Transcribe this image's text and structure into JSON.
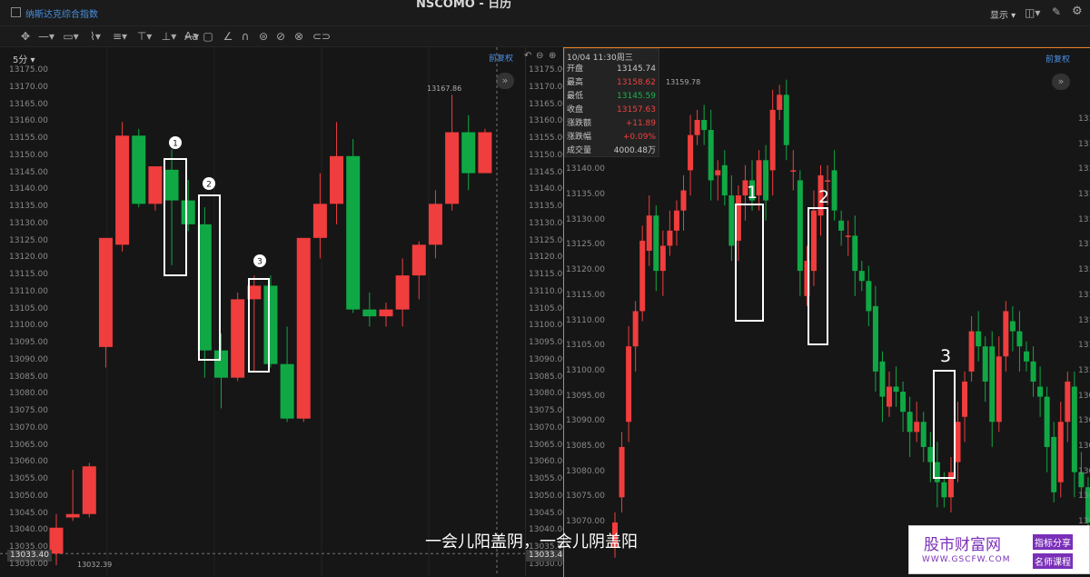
{
  "window": {
    "instrument_title": "纳斯达克综合指数",
    "center_title": "NSCOMO - 日历",
    "display_label": "显示"
  },
  "left_chart": {
    "timeframe": "5分",
    "adjust_label": "前复权",
    "high_marker": "13167.86",
    "low_marker": "13032.39",
    "last_price_tag": "13033.40",
    "y_ticks": [
      "13175.00",
      "13170.00",
      "13165.00",
      "13160.00",
      "13155.00",
      "13150.00",
      "13145.00",
      "13140.00",
      "13135.00",
      "13130.00",
      "13125.00",
      "13120.00",
      "13115.00",
      "13110.00",
      "13105.00",
      "13100.00",
      "13095.00",
      "13090.00",
      "13085.00",
      "13080.00",
      "13075.00",
      "13070.00",
      "13065.00",
      "13060.00",
      "13055.00",
      "13050.00",
      "13045.00",
      "13040.00",
      "13035.00",
      "13030.00"
    ],
    "box_labels": [
      "1",
      "2",
      "3"
    ]
  },
  "right_chart": {
    "adjust_label": "前复权",
    "high_marker": "13159.78",
    "y_ticks": [
      "13150.00",
      "13145.00",
      "13140.00",
      "13135.00",
      "13130.00",
      "13125.00",
      "13120.00",
      "13115.00",
      "13110.00",
      "13105.00",
      "13100.00",
      "13095.00",
      "13090.00",
      "13085.00",
      "13080.00",
      "13075.00",
      "13070.00"
    ],
    "box_labels": [
      "1",
      "2",
      "3"
    ]
  },
  "info": {
    "datetime": "10/04 11:30周三",
    "rows": [
      {
        "k": "开盘",
        "v": "13145.74",
        "color": "#c8c8c8"
      },
      {
        "k": "最高",
        "v": "13158.62",
        "color": "#f04040"
      },
      {
        "k": "最低",
        "v": "13145.59",
        "color": "#19b24b"
      },
      {
        "k": "收盘",
        "v": "13157.63",
        "color": "#f04040"
      },
      {
        "k": "涨跌额",
        "v": "+11.89",
        "color": "#f04040"
      },
      {
        "k": "涨跌幅",
        "v": "+0.09%",
        "color": "#f04040"
      },
      {
        "k": "成交量",
        "v": "4000.48万",
        "color": "#c8c8c8"
      }
    ]
  },
  "subtitle": "一会儿阳盖阴，一会儿阴盖阳",
  "watermark": {
    "brand": "股市财富网",
    "url": "WWW.GSCFW.COM",
    "tag1": "指标分享",
    "tag2": "名师课程"
  },
  "colors": {
    "up": "#f03d3d",
    "down": "#10a845",
    "bg": "#161616",
    "accent": "#4a90e2"
  },
  "chart_data": {
    "type": "candlestick",
    "left": {
      "candles": [
        {
          "o": 13033.4,
          "h": 13045,
          "l": 13030,
          "c": 13041
        },
        {
          "o": 13044,
          "h": 13058,
          "l": 13043,
          "c": 13045
        },
        {
          "o": 13045,
          "h": 13060,
          "l": 13044,
          "c": 13059
        },
        {
          "o": 13094,
          "h": 13124,
          "l": 13088,
          "c": 13126
        },
        {
          "o": 13124,
          "h": 13160,
          "l": 13122,
          "c": 13156
        },
        {
          "o": 13156,
          "h": 13158,
          "l": 13135,
          "c": 13136
        },
        {
          "o": 13136,
          "h": 13147,
          "l": 13134,
          "c": 13147
        },
        {
          "o": 13146,
          "h": 13152,
          "l": 13118,
          "c": 13137
        },
        {
          "o": 13137,
          "h": 13143,
          "l": 13128,
          "c": 13130
        },
        {
          "o": 13130,
          "h": 13135,
          "l": 13085,
          "c": 13093
        },
        {
          "o": 13093,
          "h": 13098,
          "l": 13076,
          "c": 13085
        },
        {
          "o": 13085,
          "h": 13110,
          "l": 13084,
          "c": 13108
        },
        {
          "o": 13108,
          "h": 13115,
          "l": 13087,
          "c": 13112
        },
        {
          "o": 13112,
          "h": 13115,
          "l": 13088,
          "c": 13089
        },
        {
          "o": 13089,
          "h": 13100,
          "l": 13072,
          "c": 13073
        },
        {
          "o": 13073,
          "h": 13126,
          "l": 13072,
          "c": 13126
        },
        {
          "o": 13126,
          "h": 13145,
          "l": 13120,
          "c": 13136
        },
        {
          "o": 13136,
          "h": 13160,
          "l": 13130,
          "c": 13150
        },
        {
          "o": 13150,
          "h": 13155,
          "l": 13104,
          "c": 13105
        },
        {
          "o": 13105,
          "h": 13110,
          "l": 13100,
          "c": 13103
        },
        {
          "o": 13103,
          "h": 13107,
          "l": 13100,
          "c": 13105
        },
        {
          "o": 13105,
          "h": 13120,
          "l": 13100,
          "c": 13115
        },
        {
          "o": 13115,
          "h": 13125,
          "l": 13108,
          "c": 13124
        },
        {
          "o": 13124,
          "h": 13140,
          "l": 13120,
          "c": 13136
        },
        {
          "o": 13136,
          "h": 13168,
          "l": 13134,
          "c": 13157
        },
        {
          "o": 13157,
          "h": 13162,
          "l": 13140,
          "c": 13145
        },
        {
          "o": 13145,
          "h": 13158,
          "l": 13145,
          "c": 13157
        }
      ]
    },
    "right": {
      "candles_close": [
        13070,
        13085,
        13105,
        13112,
        13126,
        13131,
        13120,
        13125,
        13128,
        13132,
        13136,
        13147,
        13150,
        13148,
        13138,
        13140,
        13135,
        13125,
        13135,
        13138,
        13134,
        13142,
        13134,
        13152,
        13155,
        13145,
        13140,
        13120,
        13122,
        13132,
        13139,
        13138,
        13132,
        13128,
        13127,
        13120,
        13118,
        13112,
        13100,
        13095,
        13097,
        13096,
        13092,
        13088,
        13090,
        13085,
        13082,
        13078,
        13075,
        13080,
        13090,
        13098,
        13108,
        13105,
        13098,
        13090,
        13103,
        13112,
        13108,
        13105,
        13102,
        13098,
        13095,
        13085,
        13076,
        13090,
        13098,
        13080,
        13077,
        13070,
        13075,
        13103
      ],
      "candles_open": [
        13065,
        13075,
        13090,
        13105,
        13112,
        13124,
        13131,
        13120,
        13125,
        13128,
        13132,
        13140,
        13147,
        13150,
        13148,
        13139,
        13141,
        13135,
        13126,
        13135,
        13138,
        13135,
        13142,
        13140,
        13152,
        13155,
        13140,
        13138,
        13115,
        13120,
        13131,
        13138,
        13140,
        13130,
        13127,
        13127,
        13120,
        13118,
        13113,
        13102,
        13093,
        13097,
        13096,
        13092,
        13088,
        13090,
        13085,
        13082,
        13078,
        13075,
        13082,
        13091,
        13100,
        13108,
        13105,
        13105,
        13090,
        13103,
        13110,
        13108,
        13104,
        13102,
        13097,
        13095,
        13087,
        13078,
        13090,
        13097,
        13080,
        13077,
        13071,
        13075
      ]
    }
  }
}
